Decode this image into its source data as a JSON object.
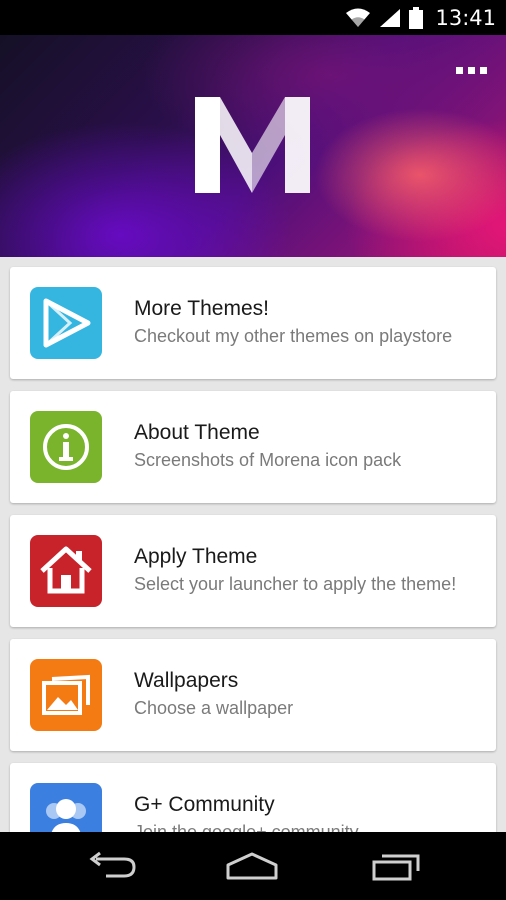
{
  "status_bar": {
    "time": "13:41"
  },
  "header": {
    "logo_letter": "M"
  },
  "menu": {
    "items": [
      {
        "title": "More Themes!",
        "subtitle": "Checkout my other themes on playstore",
        "icon": "play-store-icon",
        "color": "#35b6e1"
      },
      {
        "title": "About Theme",
        "subtitle": "Screenshots of Morena icon pack",
        "icon": "info-icon",
        "color": "#7ab42c"
      },
      {
        "title": "Apply Theme",
        "subtitle": "Select your launcher to apply the theme!",
        "icon": "home-icon",
        "color": "#c8222a"
      },
      {
        "title": "Wallpapers",
        "subtitle": "Choose a wallpaper",
        "icon": "pictures-icon",
        "color": "#f47b14"
      },
      {
        "title": "G+ Community",
        "subtitle": "Join the google+ community",
        "icon": "community-icon",
        "color": "#3b7fe0"
      }
    ]
  }
}
